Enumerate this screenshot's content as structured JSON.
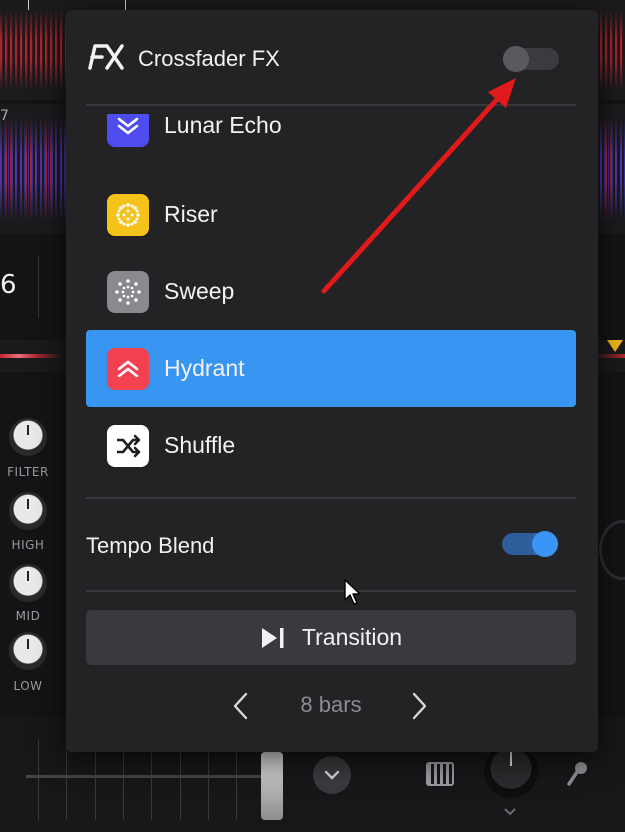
{
  "background": {
    "bpm_partial": "6",
    "knob_labels": [
      "FILTER",
      "HIGH",
      "MID",
      "LOW"
    ],
    "wave_number": "7"
  },
  "popover": {
    "title": "Crossfader FX",
    "logo_text": "FX",
    "enabled": false,
    "fx_items": [
      {
        "label": "Lunar Echo",
        "icon": "lunar-echo-icon",
        "color": "#4f4cf0",
        "selected": false
      },
      {
        "label": "Riser",
        "icon": "riser-icon",
        "color": "#f4c21a",
        "selected": false
      },
      {
        "label": "Sweep",
        "icon": "sweep-icon",
        "color": "#8a8a8e",
        "selected": false
      },
      {
        "label": "Hydrant",
        "icon": "hydrant-icon",
        "color": "#f4414f",
        "selected": true
      },
      {
        "label": "Shuffle",
        "icon": "shuffle-icon",
        "color": "#ffffff",
        "selected": false
      }
    ],
    "tempo_blend": {
      "label": "Tempo Blend",
      "enabled": true
    },
    "transition_button": {
      "label": "Transition",
      "icon": "play-skip-icon"
    },
    "bars": {
      "label": "8 bars",
      "prev_icon": "chevron-left-icon",
      "next_icon": "chevron-right-icon"
    }
  },
  "colors": {
    "accent": "#3895f2",
    "panel": "#232326",
    "annotation_arrow": "#e01a1a"
  }
}
